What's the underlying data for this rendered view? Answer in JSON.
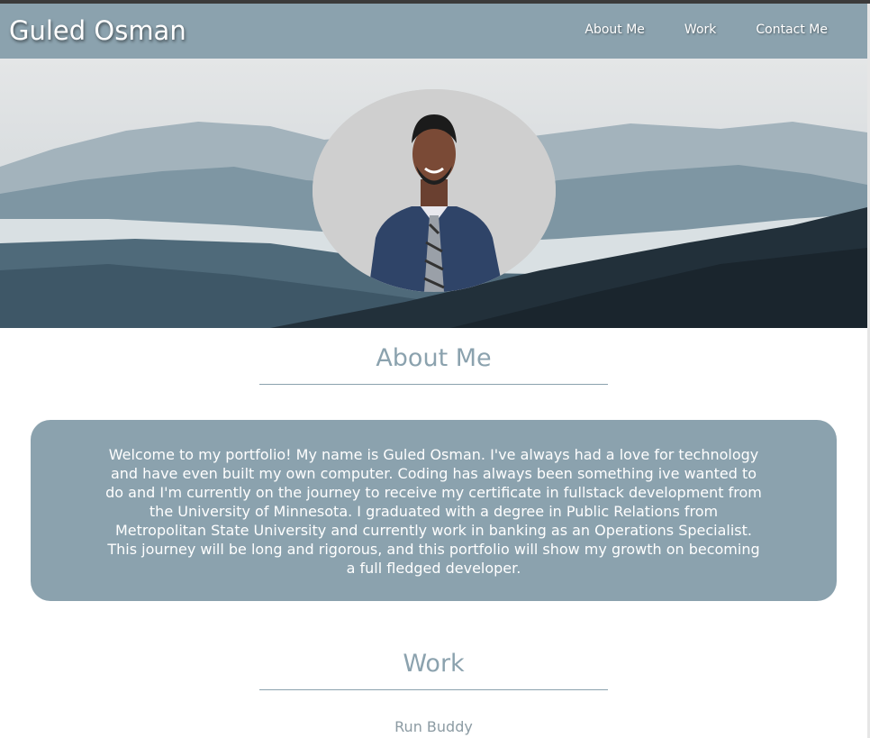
{
  "header": {
    "title": "Guled Osman",
    "nav": [
      {
        "label": "About Me"
      },
      {
        "label": "Work"
      },
      {
        "label": "Contact Me"
      }
    ]
  },
  "hero": {
    "background": "misty-mountains-image",
    "profile_photo": "profile-photo-portrait"
  },
  "about": {
    "heading": "About Me",
    "text": "Welcome to my portfolio! My name is Guled Osman. I've always had a love for technology and have even built my own computer. Coding has always been something ive wanted to do and I'm currently on the journey to receive my certificate in fullstack development from the University of Minnesota. I graduated with a degree in Public Relations from Metropolitan State University and currently work in banking as an Operations Specialist. This journey will be long and rigorous, and this portfolio will show my growth on becoming a full fledged developer."
  },
  "work": {
    "heading": "Work",
    "projects": [
      {
        "title": "Run Buddy"
      }
    ]
  },
  "colors": {
    "accent": "#8ba2ae",
    "text_on_accent": "#ffffff",
    "heading": "#8ba2ae",
    "project_text": "#8c9ba3"
  }
}
